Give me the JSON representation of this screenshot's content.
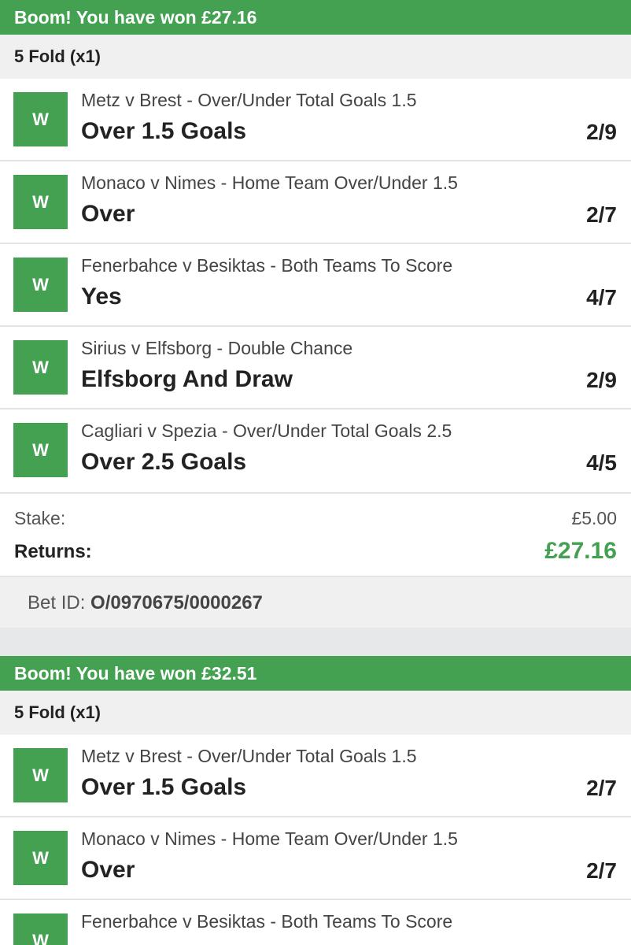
{
  "bets": [
    {
      "banner": "Boom! You have won £27.16",
      "fold": "5 Fold (x1)",
      "legs": [
        {
          "status": "W",
          "market": "Metz v Brest - Over/Under Total Goals 1.5",
          "selection": "Over 1.5 Goals",
          "odds": "2/9"
        },
        {
          "status": "W",
          "market": "Monaco v Nimes - Home Team Over/Under 1.5",
          "selection": "Over",
          "odds": "2/7"
        },
        {
          "status": "W",
          "market": "Fenerbahce v Besiktas - Both Teams To Score",
          "selection": "Yes",
          "odds": "4/7"
        },
        {
          "status": "W",
          "market": "Sirius v Elfsborg - Double Chance",
          "selection": "Elfsborg And Draw",
          "odds": "2/9"
        },
        {
          "status": "W",
          "market": "Cagliari v Spezia - Over/Under Total Goals 2.5",
          "selection": "Over 2.5 Goals",
          "odds": "4/5"
        }
      ],
      "stake_label": "Stake:",
      "stake_value": "£5.00",
      "returns_label": "Returns:",
      "returns_value": "£27.16",
      "bet_id_label": "Bet ID:",
      "bet_id_value": "O/0970675/0000267"
    },
    {
      "banner": "Boom! You have won £32.51",
      "fold": "5 Fold (x1)",
      "legs": [
        {
          "status": "W",
          "market": "Metz v Brest - Over/Under Total Goals 1.5",
          "selection": "Over 1.5 Goals",
          "odds": "2/7"
        },
        {
          "status": "W",
          "market": "Monaco v Nimes - Home Team Over/Under 1.5",
          "selection": "Over",
          "odds": "2/7"
        },
        {
          "status": "W",
          "market": "Fenerbahce v Besiktas - Both Teams To Score",
          "selection": "",
          "odds": ""
        }
      ]
    }
  ],
  "colors": {
    "win_green": "#44a152",
    "header_grey": "#f0f0f1",
    "page_bg": "#e6e8ea"
  }
}
